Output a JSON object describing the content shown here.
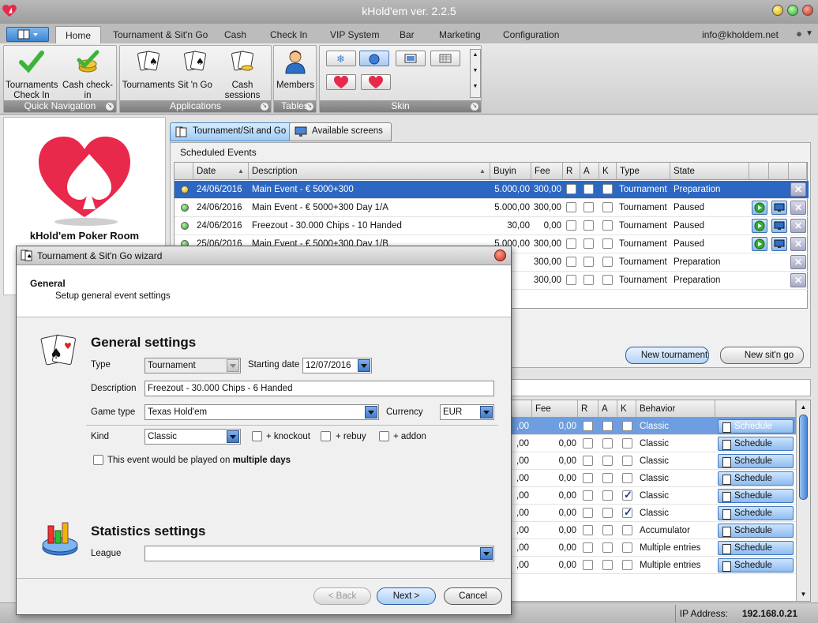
{
  "window": {
    "title": "kHold'em ver. 2.2.5"
  },
  "menu": {
    "tabs": [
      "Home",
      "Tournament & Sit'n Go",
      "Cash",
      "Check In",
      "VIP System",
      "Bar",
      "Marketing",
      "Configuration"
    ],
    "email": "info@kholdem.net"
  },
  "ribbon": {
    "groups": [
      {
        "label": "Quick Navigation",
        "buttons": [
          {
            "label1": "Tournaments",
            "label2": "Check In",
            "icon": "checkmark-icon"
          },
          {
            "label1": "Cash check-in",
            "label2": "",
            "icon": "coins-check-icon"
          }
        ]
      },
      {
        "label": "Applications",
        "buttons": [
          {
            "label1": "Tournaments",
            "icon": "cards-icon"
          },
          {
            "label1": "Sit 'n Go",
            "icon": "cards-icon"
          },
          {
            "label1": "Cash sessions",
            "icon": "cards-icon"
          }
        ]
      },
      {
        "label": "Tables",
        "buttons": [
          {
            "label1": "Members",
            "icon": "member-icon"
          }
        ]
      },
      {
        "label": "Skin",
        "swatches": [
          "snowflake",
          "apple",
          "monitor",
          "grid",
          "heart",
          "heart"
        ]
      }
    ]
  },
  "left": {
    "room_name": "kHold'em Poker Room"
  },
  "subtabs": [
    "Tournament/Sit and Go",
    "Available screens"
  ],
  "scheduled": {
    "title": "Scheduled Events",
    "columns": [
      "Date",
      "Description",
      "Buyin",
      "Fee",
      "R",
      "A",
      "K",
      "Type",
      "State"
    ],
    "rows": [
      {
        "date": "24/06/2016",
        "description": "Main Event - € 5000+300",
        "buyin": "5.000,00",
        "fee": "300,00",
        "type": "Tournament",
        "state": "Preparation",
        "status": "yellow",
        "actions": false
      },
      {
        "date": "24/06/2016",
        "description": "Main Event - € 5000+300 Day 1/A",
        "buyin": "5.000,00",
        "fee": "300,00",
        "type": "Tournament",
        "state": "Paused",
        "status": "green",
        "actions": true
      },
      {
        "date": "24/06/2016",
        "description": "Freezout - 30.000 Chips - 10 Handed",
        "buyin": "30,00",
        "fee": "0,00",
        "type": "Tournament",
        "state": "Paused",
        "status": "green",
        "actions": true
      },
      {
        "date": "25/06/2016",
        "description": "Main Event - € 5000+300 Day 1/B",
        "buyin": "5.000,00",
        "fee": "300,00",
        "type": "Tournament",
        "state": "Paused",
        "status": "green",
        "actions": true
      },
      {
        "date": "",
        "description": "",
        "buyin": "",
        "fee": "300,00",
        "type": "Tournament",
        "state": "Preparation",
        "status": "none",
        "actions": false
      },
      {
        "date": "",
        "description": "",
        "buyin": "",
        "fee": "300,00",
        "type": "Tournament",
        "state": "Preparation",
        "status": "none",
        "actions": false
      }
    ],
    "new_tournament": "New tournament",
    "new_sitngo": "New sit'n go"
  },
  "sitngo": {
    "columns": [
      "Fee",
      "R",
      "A",
      "K",
      "Behavior"
    ],
    "rows": [
      {
        "buyin": ",00",
        "fee": "0,00",
        "k": false,
        "behavior": "Classic",
        "sel": true
      },
      {
        "buyin": ",00",
        "fee": "0,00",
        "k": false,
        "behavior": "Classic",
        "sel": false
      },
      {
        "buyin": ",00",
        "fee": "0,00",
        "k": false,
        "behavior": "Classic",
        "sel": false
      },
      {
        "buyin": ",00",
        "fee": "0,00",
        "k": false,
        "behavior": "Classic",
        "sel": false
      },
      {
        "buyin": ",00",
        "fee": "0,00",
        "k": true,
        "behavior": "Classic",
        "sel": false
      },
      {
        "buyin": ",00",
        "fee": "0,00",
        "k": true,
        "behavior": "Classic",
        "sel": false
      },
      {
        "buyin": ",00",
        "fee": "0,00",
        "k": false,
        "behavior": "Accumulator",
        "sel": false
      },
      {
        "buyin": ",00",
        "fee": "0,00",
        "k": false,
        "behavior": "Multiple entries",
        "sel": false
      },
      {
        "buyin": ",00",
        "fee": "0,00",
        "k": false,
        "behavior": "Multiple entries",
        "sel": false
      }
    ],
    "schedule_label": "Schedule"
  },
  "status": {
    "ip_label": "IP Address:",
    "ip": "192.168.0.21"
  },
  "dialog": {
    "title": "Tournament & Sit'n Go wizard",
    "header": "General",
    "subheader": "Setup general event settings",
    "general_title": "General settings",
    "type_label": "Type",
    "type_value": "Tournament",
    "start_label": "Starting date",
    "start_value": "12/07/2016",
    "desc_label": "Description",
    "desc_value": "Freezout - 30.000 Chips - 6 Handed",
    "game_label": "Game type",
    "game_value": "Texas Hold'em",
    "currency_label": "Currency",
    "currency_value": "EUR",
    "kind_label": "Kind",
    "kind_value": "Classic",
    "knockout": "+ knockout",
    "rebuy": "+ rebuy",
    "addon": "+ addon",
    "multi_prefix": "This event would be played on",
    "multi_bold": "multiple days",
    "stats_title": "Statistics settings",
    "league_label": "League",
    "back": "< Back",
    "next": "Next >",
    "cancel": "Cancel"
  },
  "colors": {
    "selection": "#2c67c2",
    "heart": "#e8294b",
    "ok": "#3cb43c",
    "warn": "#f0c000"
  }
}
